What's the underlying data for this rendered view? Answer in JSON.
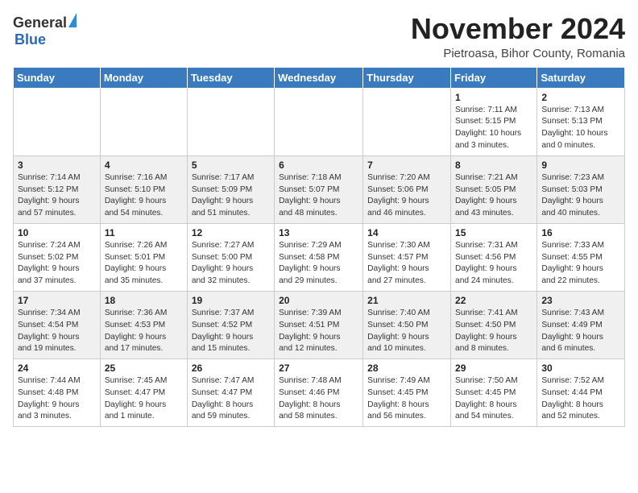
{
  "logo": {
    "general": "General",
    "blue": "Blue"
  },
  "title": "November 2024",
  "subtitle": "Pietroasa, Bihor County, Romania",
  "headers": [
    "Sunday",
    "Monday",
    "Tuesday",
    "Wednesday",
    "Thursday",
    "Friday",
    "Saturday"
  ],
  "weeks": [
    [
      {
        "day": "",
        "info": ""
      },
      {
        "day": "",
        "info": ""
      },
      {
        "day": "",
        "info": ""
      },
      {
        "day": "",
        "info": ""
      },
      {
        "day": "",
        "info": ""
      },
      {
        "day": "1",
        "info": "Sunrise: 7:11 AM\nSunset: 5:15 PM\nDaylight: 10 hours\nand 3 minutes."
      },
      {
        "day": "2",
        "info": "Sunrise: 7:13 AM\nSunset: 5:13 PM\nDaylight: 10 hours\nand 0 minutes."
      }
    ],
    [
      {
        "day": "3",
        "info": "Sunrise: 7:14 AM\nSunset: 5:12 PM\nDaylight: 9 hours\nand 57 minutes."
      },
      {
        "day": "4",
        "info": "Sunrise: 7:16 AM\nSunset: 5:10 PM\nDaylight: 9 hours\nand 54 minutes."
      },
      {
        "day": "5",
        "info": "Sunrise: 7:17 AM\nSunset: 5:09 PM\nDaylight: 9 hours\nand 51 minutes."
      },
      {
        "day": "6",
        "info": "Sunrise: 7:18 AM\nSunset: 5:07 PM\nDaylight: 9 hours\nand 48 minutes."
      },
      {
        "day": "7",
        "info": "Sunrise: 7:20 AM\nSunset: 5:06 PM\nDaylight: 9 hours\nand 46 minutes."
      },
      {
        "day": "8",
        "info": "Sunrise: 7:21 AM\nSunset: 5:05 PM\nDaylight: 9 hours\nand 43 minutes."
      },
      {
        "day": "9",
        "info": "Sunrise: 7:23 AM\nSunset: 5:03 PM\nDaylight: 9 hours\nand 40 minutes."
      }
    ],
    [
      {
        "day": "10",
        "info": "Sunrise: 7:24 AM\nSunset: 5:02 PM\nDaylight: 9 hours\nand 37 minutes."
      },
      {
        "day": "11",
        "info": "Sunrise: 7:26 AM\nSunset: 5:01 PM\nDaylight: 9 hours\nand 35 minutes."
      },
      {
        "day": "12",
        "info": "Sunrise: 7:27 AM\nSunset: 5:00 PM\nDaylight: 9 hours\nand 32 minutes."
      },
      {
        "day": "13",
        "info": "Sunrise: 7:29 AM\nSunset: 4:58 PM\nDaylight: 9 hours\nand 29 minutes."
      },
      {
        "day": "14",
        "info": "Sunrise: 7:30 AM\nSunset: 4:57 PM\nDaylight: 9 hours\nand 27 minutes."
      },
      {
        "day": "15",
        "info": "Sunrise: 7:31 AM\nSunset: 4:56 PM\nDaylight: 9 hours\nand 24 minutes."
      },
      {
        "day": "16",
        "info": "Sunrise: 7:33 AM\nSunset: 4:55 PM\nDaylight: 9 hours\nand 22 minutes."
      }
    ],
    [
      {
        "day": "17",
        "info": "Sunrise: 7:34 AM\nSunset: 4:54 PM\nDaylight: 9 hours\nand 19 minutes."
      },
      {
        "day": "18",
        "info": "Sunrise: 7:36 AM\nSunset: 4:53 PM\nDaylight: 9 hours\nand 17 minutes."
      },
      {
        "day": "19",
        "info": "Sunrise: 7:37 AM\nSunset: 4:52 PM\nDaylight: 9 hours\nand 15 minutes."
      },
      {
        "day": "20",
        "info": "Sunrise: 7:39 AM\nSunset: 4:51 PM\nDaylight: 9 hours\nand 12 minutes."
      },
      {
        "day": "21",
        "info": "Sunrise: 7:40 AM\nSunset: 4:50 PM\nDaylight: 9 hours\nand 10 minutes."
      },
      {
        "day": "22",
        "info": "Sunrise: 7:41 AM\nSunset: 4:50 PM\nDaylight: 9 hours\nand 8 minutes."
      },
      {
        "day": "23",
        "info": "Sunrise: 7:43 AM\nSunset: 4:49 PM\nDaylight: 9 hours\nand 6 minutes."
      }
    ],
    [
      {
        "day": "24",
        "info": "Sunrise: 7:44 AM\nSunset: 4:48 PM\nDaylight: 9 hours\nand 3 minutes."
      },
      {
        "day": "25",
        "info": "Sunrise: 7:45 AM\nSunset: 4:47 PM\nDaylight: 9 hours\nand 1 minute."
      },
      {
        "day": "26",
        "info": "Sunrise: 7:47 AM\nSunset: 4:47 PM\nDaylight: 8 hours\nand 59 minutes."
      },
      {
        "day": "27",
        "info": "Sunrise: 7:48 AM\nSunset: 4:46 PM\nDaylight: 8 hours\nand 58 minutes."
      },
      {
        "day": "28",
        "info": "Sunrise: 7:49 AM\nSunset: 4:45 PM\nDaylight: 8 hours\nand 56 minutes."
      },
      {
        "day": "29",
        "info": "Sunrise: 7:50 AM\nSunset: 4:45 PM\nDaylight: 8 hours\nand 54 minutes."
      },
      {
        "day": "30",
        "info": "Sunrise: 7:52 AM\nSunset: 4:44 PM\nDaylight: 8 hours\nand 52 minutes."
      }
    ]
  ]
}
